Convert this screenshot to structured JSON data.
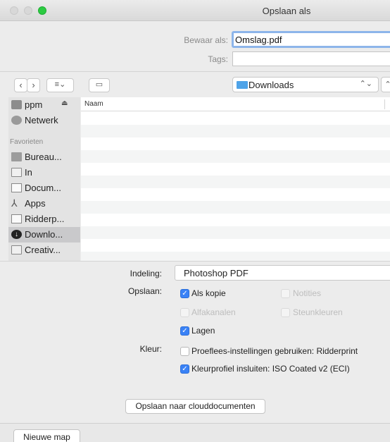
{
  "window": {
    "title": "Opslaan als"
  },
  "save": {
    "saveas_label": "Bewaar als:",
    "filename": "Omslag.pdf",
    "tags_label": "Tags:",
    "tags_value": ""
  },
  "toolbar": {
    "back_icon": "chevron-left-icon",
    "forward_icon": "chevron-right-icon",
    "view_icon": "list-view-icon",
    "new_folder_icon": "new-folder-icon",
    "location": "Downloads",
    "location_arrows": "⌃⌄",
    "expand_icon": "chevron-up-icon"
  },
  "sidebar": {
    "items_top": [
      {
        "label": "ppm",
        "icon": "drive-icon"
      },
      {
        "label": "Netwerk",
        "icon": "network-icon"
      }
    ],
    "favorites_heading": "Favorieten",
    "favorites": [
      {
        "label": "Bureau...",
        "icon": "desktop-icon"
      },
      {
        "label": "In",
        "icon": "folder-icon"
      },
      {
        "label": "Docum...",
        "icon": "documents-icon"
      },
      {
        "label": "Apps",
        "icon": "apps-icon"
      },
      {
        "label": "Ridderp...",
        "icon": "document-icon"
      },
      {
        "label": "Downlo...",
        "icon": "downloads-icon",
        "selected": true
      },
      {
        "label": "Creativ...",
        "icon": "folder-icon"
      }
    ]
  },
  "filelist": {
    "column_name": "Naam"
  },
  "options": {
    "format_label": "Indeling:",
    "format_value": "Photoshop PDF",
    "save_label": "Opslaan:",
    "as_copy": "Als kopie",
    "notes": "Notities",
    "alpha": "Alfakanalen",
    "spot": "Steunkleuren",
    "layers": "Lagen",
    "color_label": "Kleur:",
    "proof": "Proeflees-instellingen gebruiken: Ridderprint",
    "icc": "Kleurprofiel insluiten: ISO Coated v2 (ECI)",
    "cloud_button": "Opslaan naar clouddocumenten",
    "new_folder_button": "Nieuwe map"
  },
  "colors": {
    "accent": "#3a82f6",
    "focus_ring": "#8db5ea",
    "folder": "#4ea3e8",
    "maximize": "#2ccb42"
  }
}
